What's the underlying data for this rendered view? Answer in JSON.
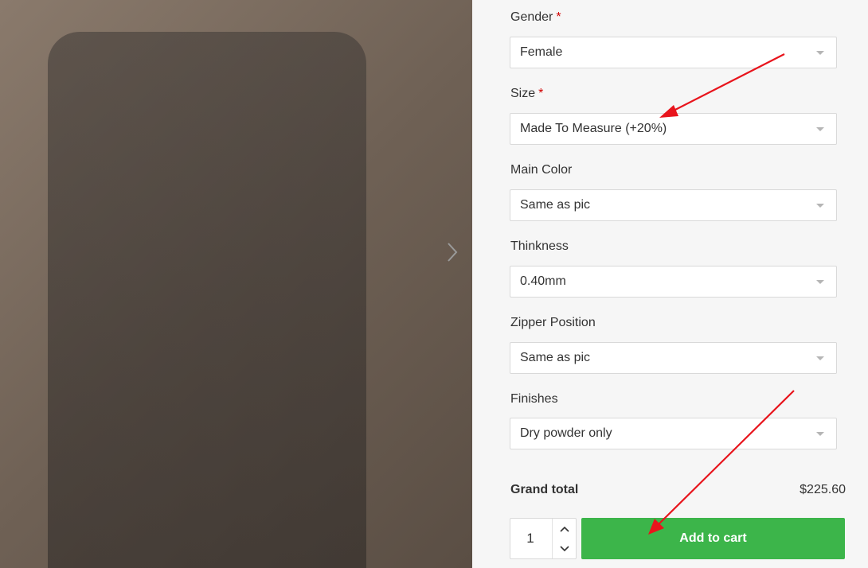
{
  "colors": {
    "accent_green": "#3cb54a",
    "required_star": "#d10000",
    "annotation_red": "#e8141c",
    "panel_bg": "#f6f6f6"
  },
  "gallery": {
    "next_icon": "chevron-right-icon"
  },
  "form": {
    "required_marker": "*",
    "fields": [
      {
        "label": "Gender",
        "required": true,
        "value": "Female"
      },
      {
        "label": "Size",
        "required": true,
        "value": "Made To Measure (+20%)"
      },
      {
        "label": "Main Color",
        "required": false,
        "value": "Same as pic"
      },
      {
        "label": "Thinkness",
        "required": false,
        "value": "0.40mm"
      },
      {
        "label": "Zipper Position",
        "required": false,
        "value": "Same as pic"
      },
      {
        "label": "Finishes",
        "required": false,
        "value": "Dry powder only"
      }
    ]
  },
  "totals": {
    "label": "Grand total",
    "value": "$225.60"
  },
  "cart": {
    "quantity": "1",
    "add_label": "Add to cart"
  }
}
